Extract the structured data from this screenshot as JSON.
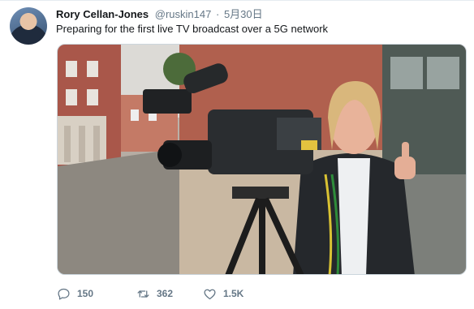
{
  "tweet": {
    "author_name": "Rory Cellan-Jones",
    "handle": "@ruskin147",
    "dot": "·",
    "date": "5月30日",
    "text": "Preparing for the first live TV broadcast over a 5G network"
  },
  "actions": {
    "reply": {
      "icon": "reply-icon",
      "count": "150"
    },
    "retweet": {
      "icon": "retweet-icon",
      "count": "362"
    },
    "like": {
      "icon": "heart-icon",
      "count": "1.5K"
    }
  },
  "colors": {
    "name_text": "#14171a",
    "secondary_text": "#657786",
    "border": "#e6ecf0"
  }
}
